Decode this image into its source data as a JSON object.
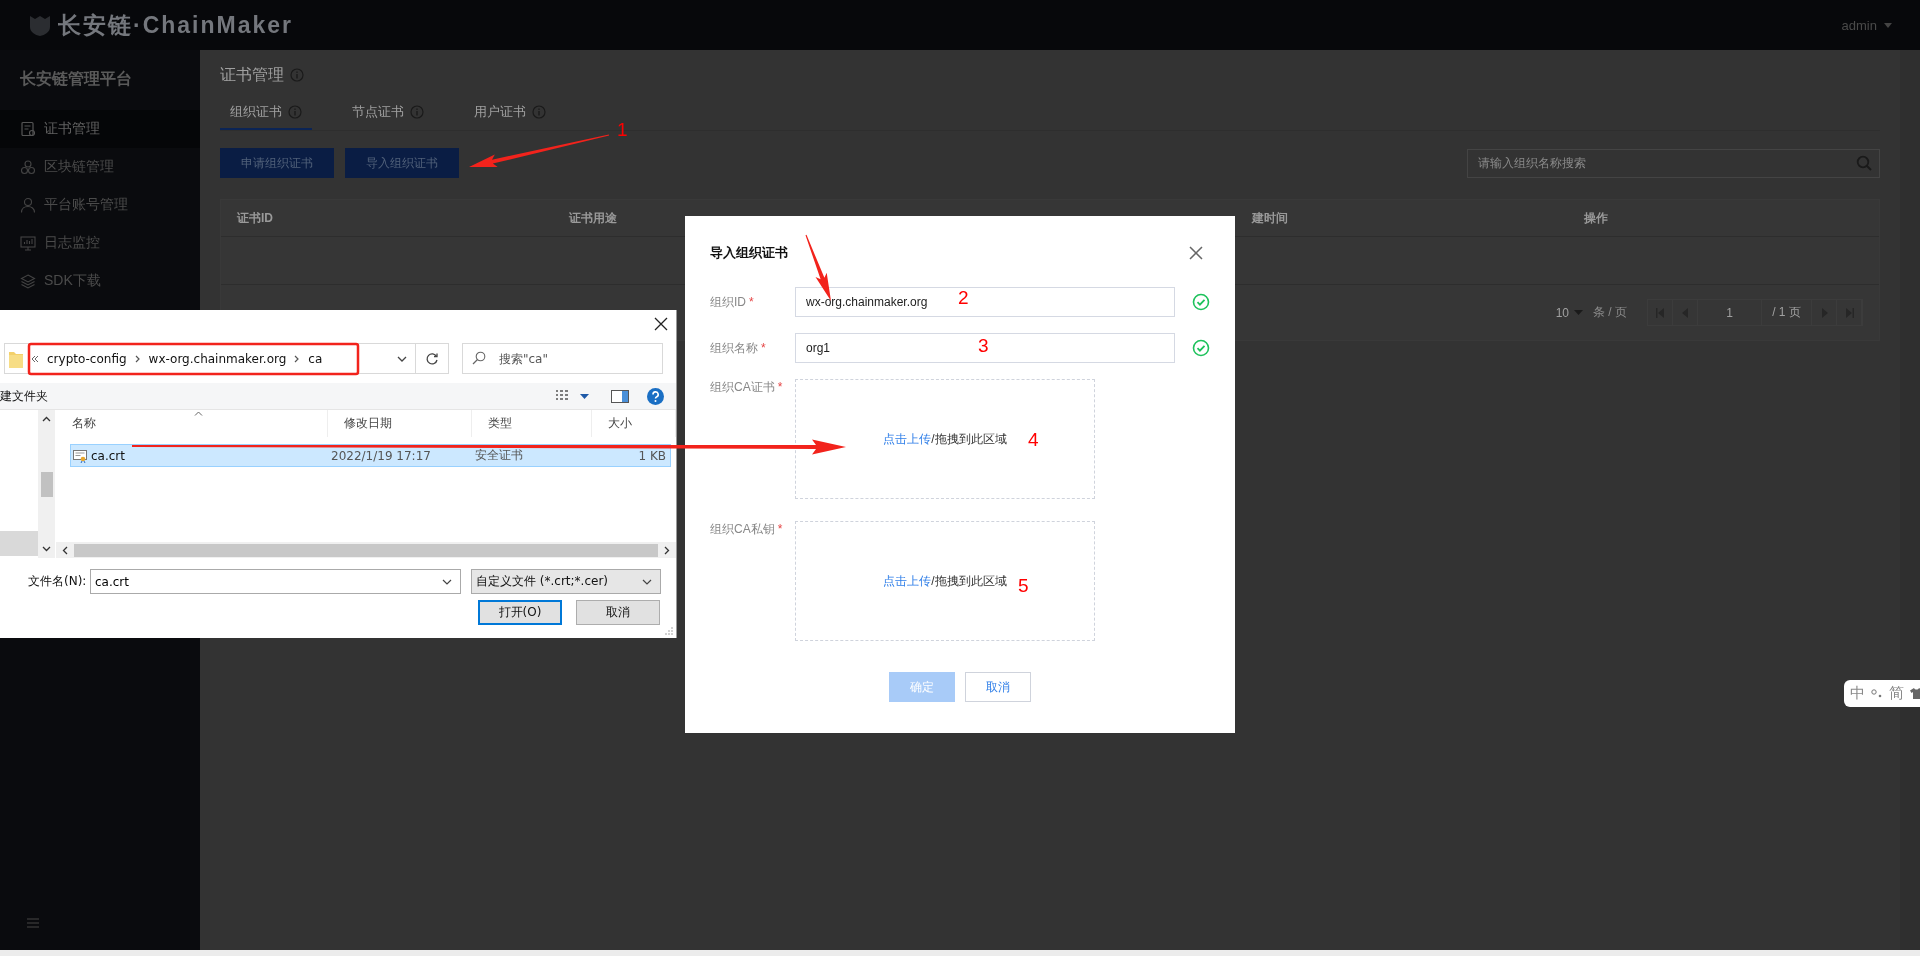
{
  "app_header": {
    "logo_text": "长安链·ChainMaker",
    "user": "admin"
  },
  "sidebar": {
    "title": "长安链管理平台",
    "items": [
      {
        "label": "证书管理",
        "selected": true
      },
      {
        "label": "区块链管理",
        "selected": false
      },
      {
        "label": "平台账号管理",
        "selected": false
      },
      {
        "label": "日志监控",
        "selected": false
      },
      {
        "label": "SDK下载",
        "selected": false
      }
    ]
  },
  "page": {
    "title": "证书管理",
    "tabs": [
      {
        "label": "组织证书",
        "selected": true
      },
      {
        "label": "节点证书",
        "selected": false
      },
      {
        "label": "用户证书",
        "selected": false
      }
    ],
    "buttons": [
      "申请组织证书",
      "导入组织证书"
    ],
    "search": {
      "placeholder": "请输入组织名称搜索"
    },
    "table": {
      "columns": [
        "证书ID",
        "证书用途",
        "建时间",
        "操作"
      ]
    },
    "pagination": {
      "page_size": "10",
      "per_page_label": "条 / 页",
      "page": "1",
      "total": "/ 1 页"
    }
  },
  "modal": {
    "title": "导入组织证书",
    "fields": [
      {
        "kind": "input",
        "label": "组织ID",
        "required_mark": "*",
        "value": "wx-org.chainmaker.org",
        "valid": true
      },
      {
        "kind": "input",
        "label": "组织名称",
        "required_mark": "*",
        "value": "org1",
        "valid": true
      },
      {
        "kind": "upload",
        "label": "组织CA证书",
        "required_mark": "*",
        "link": "点击上传",
        "text": "/拖拽到此区域"
      },
      {
        "kind": "upload",
        "label": "组织CA私钥",
        "required_mark": "*",
        "link": "点击上传",
        "text": "/拖拽到此区域"
      }
    ],
    "buttons": [
      {
        "label": "确定",
        "disabled": true
      },
      {
        "label": "取消",
        "disabled": false
      }
    ]
  },
  "file_dialog": {
    "path": [
      "crypto-config",
      "wx-org.chainmaker.org",
      "ca"
    ],
    "search": {
      "placeholder": "搜索\"ca\""
    },
    "toolbar_label": "建文件夹",
    "columns": [
      "名称",
      "修改日期",
      "类型",
      "大小"
    ],
    "files": [
      {
        "name": "ca.crt",
        "modified": "2022/1/19 17:17",
        "type": "安全证书",
        "size": "1 KB",
        "selected": true
      }
    ],
    "filename_label": "文件名(N):",
    "filename": "ca.crt",
    "filter": "自定义文件 (*.crt;*.cer)",
    "buttons": [
      "打开(O)",
      "取消"
    ]
  },
  "ime_bar": {
    "mode": "中",
    "script": "简"
  },
  "annotations": [
    {
      "label": "1"
    },
    {
      "label": "2"
    },
    {
      "label": "3"
    },
    {
      "label": "4"
    },
    {
      "label": "5"
    }
  ]
}
